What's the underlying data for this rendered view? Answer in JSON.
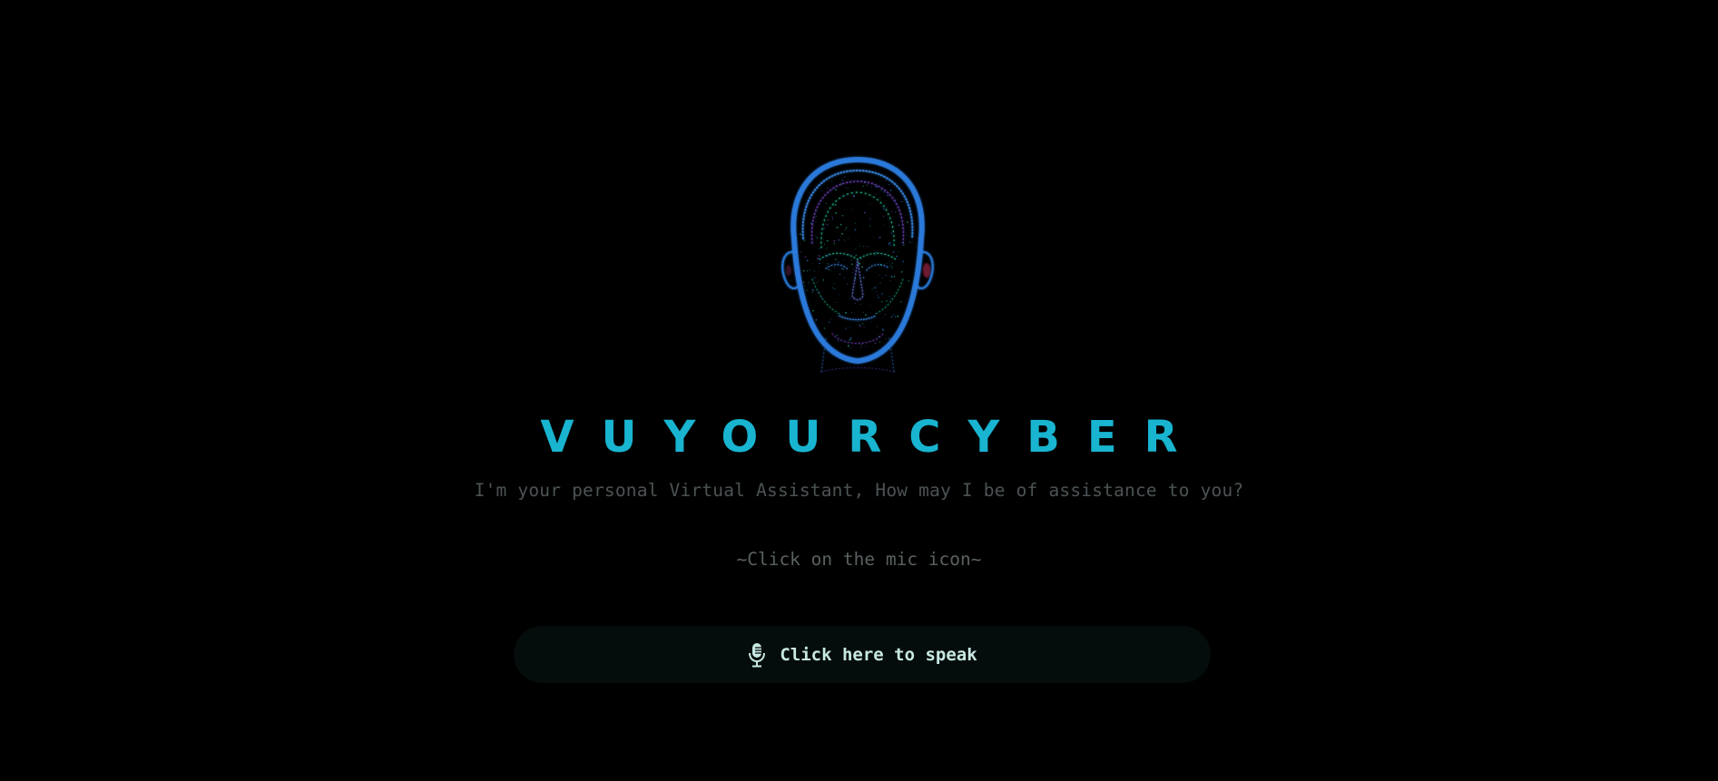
{
  "app": {
    "title": "VUYOURCYBER",
    "subtitle": "I'm your personal Virtual Assistant, How may I be of assistance to you?",
    "hint": "~Click on the mic icon~"
  },
  "avatar": {
    "icon": "wireframe-head-icon",
    "description": "Particle wireframe head",
    "colors": {
      "primary": "#2b7de0",
      "accent": "#27d6a8",
      "secondary": "#7a4ad8",
      "ear_tint": "#8a1f3c"
    }
  },
  "speak_button": {
    "label": "Click here to speak",
    "icon": "microphone-icon"
  },
  "theme": {
    "background": "#000000",
    "title_color": "#18b4d0",
    "text_muted": "#4c5355",
    "button_bg": "#050c0c",
    "button_text": "#c7e8e2"
  }
}
